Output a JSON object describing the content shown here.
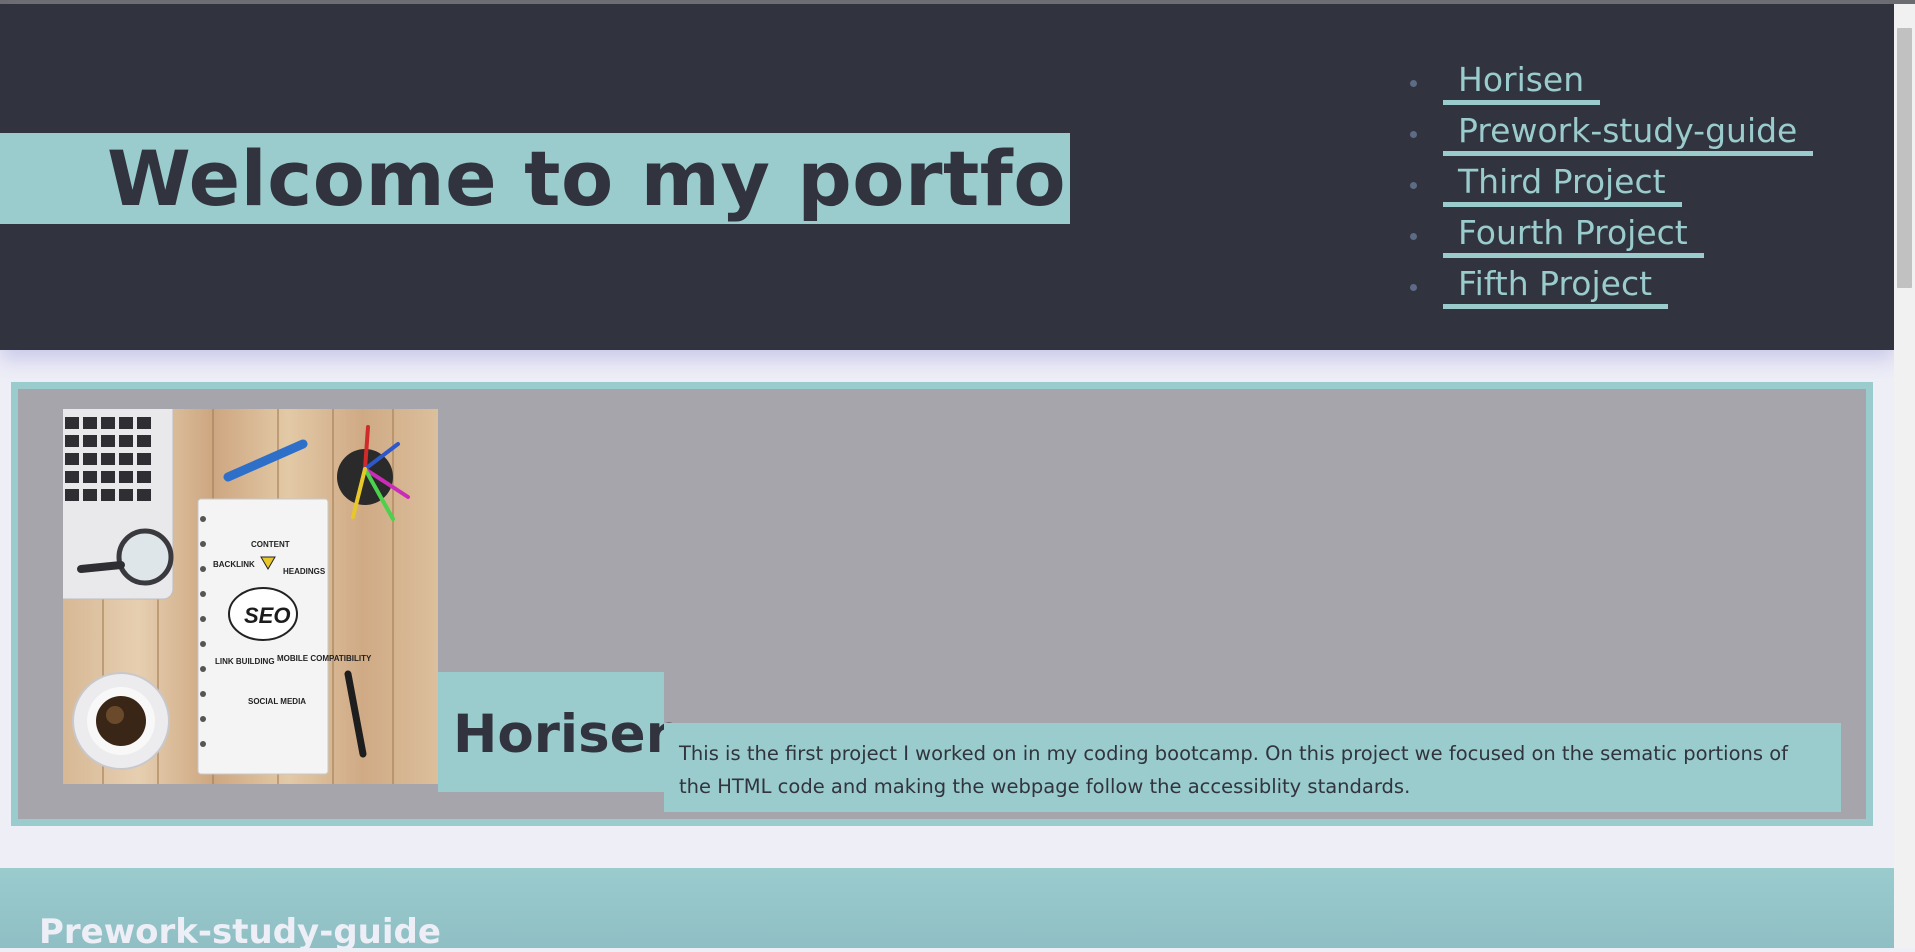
{
  "header": {
    "title": "Welcome to my portfolio!!",
    "nav": [
      {
        "label": "Horisen"
      },
      {
        "label": "Prework-study-guide"
      },
      {
        "label": "Third Project"
      },
      {
        "label": "Fourth Project"
      },
      {
        "label": "Fifth Project"
      }
    ]
  },
  "project": {
    "title": "Horisen",
    "description": "This is the first project I worked on in my coding bootcamp. On this project we focused on the sematic portions of the HTML code and making the webpage follow the accessiblity standards.",
    "image": {
      "alt": "SEO notebook on a wooden desk",
      "labels": [
        "CONTENT",
        "BACKLINK",
        "HEADINGS",
        "SEO",
        "LINK BUILDING",
        "MOBILE COMPATIBILITY",
        "SOCIAL MEDIA"
      ]
    }
  },
  "section2": {
    "title": "Prework-study-guide"
  },
  "colors": {
    "header_bg": "#31343e",
    "accent": "#9acbcd",
    "card_bg": "#a6a5ab",
    "page_bg": "#eeeef7"
  }
}
